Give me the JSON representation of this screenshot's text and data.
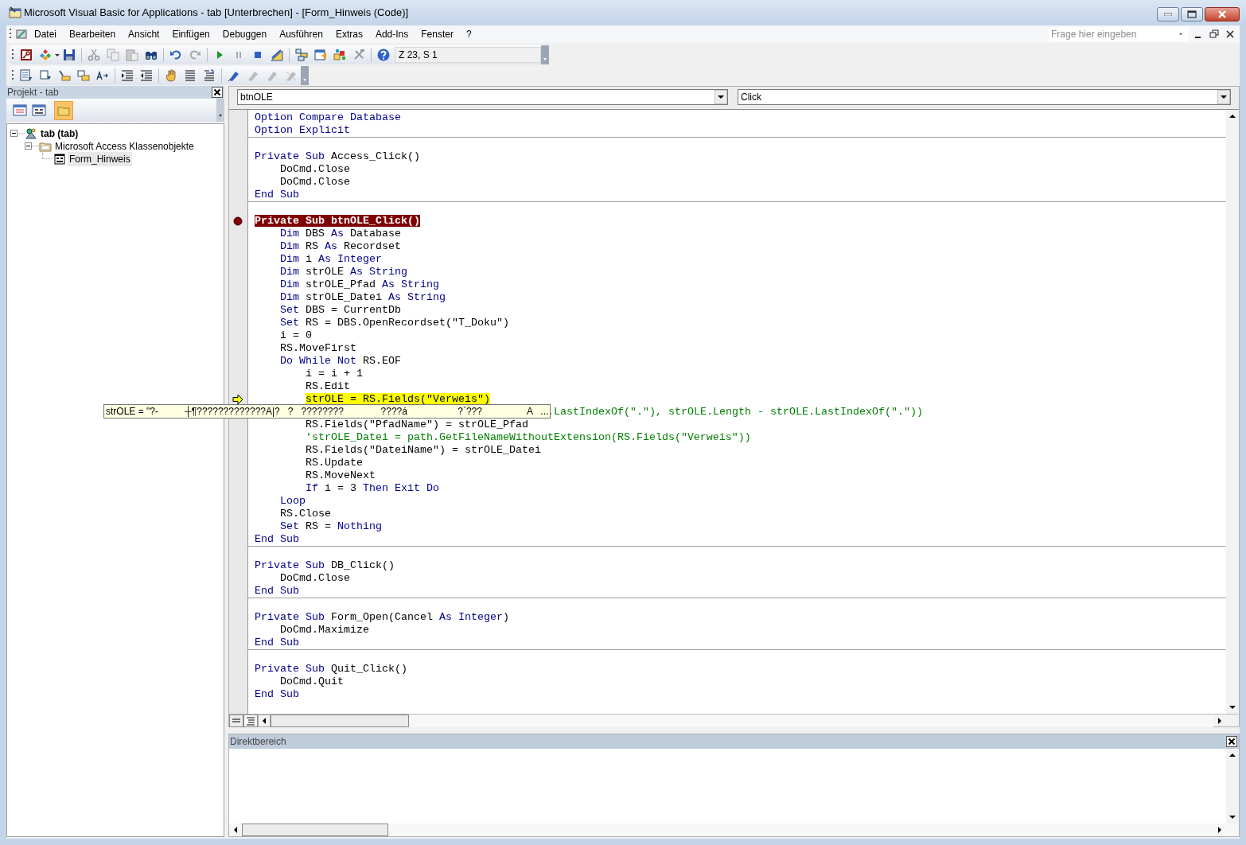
{
  "window": {
    "title": "Microsoft Visual Basic for Applications - tab [Unterbrechen] - [Form_Hinweis (Code)]"
  },
  "menu": [
    "Datei",
    "Bearbeiten",
    "Ansicht",
    "Einfügen",
    "Debuggen",
    "Ausführen",
    "Extras",
    "Add-Ins",
    "Fenster",
    "?"
  ],
  "help_search": {
    "placeholder": "Frage hier eingeben"
  },
  "cursor_position": "Z 23, S 1",
  "project_pane": {
    "title": "Projekt - tab",
    "tree": [
      {
        "label": "tab (tab)",
        "kind": "project",
        "expanded": true,
        "selected": false,
        "children": [
          {
            "label": "Microsoft Access Klassenobjekte",
            "kind": "folder",
            "expanded": true,
            "selected": false,
            "children": [
              {
                "label": "Form_Hinweis",
                "kind": "form",
                "selected": true
              }
            ]
          }
        ]
      }
    ]
  },
  "code_window": {
    "object_dropdown": "btnOLE",
    "procedure_dropdown": "Click",
    "blocks": [
      [
        {
          "kind": "code",
          "parts": [
            {
              "kind": "keyword",
              "text": "Option Compare Database"
            }
          ]
        },
        {
          "kind": "code",
          "parts": [
            {
              "kind": "keyword",
              "text": "Option Explicit"
            }
          ]
        }
      ],
      [
        {
          "kind": "blank"
        },
        {
          "kind": "code",
          "parts": [
            {
              "kind": "keyword",
              "text": "Private Sub "
            },
            {
              "kind": "plain",
              "text": "Access_Click()"
            }
          ]
        },
        {
          "kind": "code",
          "parts": [
            {
              "kind": "plain",
              "text": "    DoCmd.Close"
            }
          ]
        },
        {
          "kind": "code",
          "parts": [
            {
              "kind": "plain",
              "text": "    DoCmd.Close"
            }
          ]
        },
        {
          "kind": "code",
          "parts": [
            {
              "kind": "keyword",
              "text": "End Sub"
            }
          ]
        }
      ],
      [
        {
          "kind": "blank"
        },
        {
          "kind": "breakpoint",
          "parts": [
            {
              "kind": "keyword",
              "text": "Private Sub "
            },
            {
              "kind": "plain",
              "text": "btnOLE_Click()"
            }
          ]
        },
        {
          "kind": "code",
          "parts": [
            {
              "kind": "keyword",
              "text": "    Dim "
            },
            {
              "kind": "plain",
              "text": "DBS "
            },
            {
              "kind": "keyword",
              "text": "As "
            },
            {
              "kind": "plain",
              "text": "Database"
            }
          ]
        },
        {
          "kind": "code",
          "parts": [
            {
              "kind": "keyword",
              "text": "    Dim "
            },
            {
              "kind": "plain",
              "text": "RS "
            },
            {
              "kind": "keyword",
              "text": "As "
            },
            {
              "kind": "plain",
              "text": "Recordset"
            }
          ]
        },
        {
          "kind": "code",
          "parts": [
            {
              "kind": "keyword",
              "text": "    Dim "
            },
            {
              "kind": "plain",
              "text": "i "
            },
            {
              "kind": "keyword",
              "text": "As Integer"
            }
          ]
        },
        {
          "kind": "code",
          "parts": [
            {
              "kind": "keyword",
              "text": "    Dim "
            },
            {
              "kind": "plain",
              "text": "strOLE "
            },
            {
              "kind": "keyword",
              "text": "As String"
            }
          ]
        },
        {
          "kind": "code",
          "parts": [
            {
              "kind": "keyword",
              "text": "    Dim "
            },
            {
              "kind": "plain",
              "text": "strOLE_Pfad "
            },
            {
              "kind": "keyword",
              "text": "As String"
            }
          ]
        },
        {
          "kind": "code",
          "parts": [
            {
              "kind": "keyword",
              "text": "    Dim "
            },
            {
              "kind": "plain",
              "text": "strOLE_Datei "
            },
            {
              "kind": "keyword",
              "text": "As String"
            }
          ]
        },
        {
          "kind": "code",
          "parts": [
            {
              "kind": "keyword",
              "text": "    Set "
            },
            {
              "kind": "plain",
              "text": "DBS = CurrentDb"
            }
          ]
        },
        {
          "kind": "code",
          "parts": [
            {
              "kind": "keyword",
              "text": "    Set "
            },
            {
              "kind": "plain",
              "text": "RS = DBS.OpenRecordset(\"T_Doku\")"
            }
          ]
        },
        {
          "kind": "code",
          "parts": [
            {
              "kind": "plain",
              "text": "    i = 0"
            }
          ]
        },
        {
          "kind": "code",
          "parts": [
            {
              "kind": "plain",
              "text": "    RS.MoveFirst"
            }
          ]
        },
        {
          "kind": "code",
          "parts": [
            {
              "kind": "keyword",
              "text": "    Do While Not "
            },
            {
              "kind": "plain",
              "text": "RS.EOF"
            }
          ]
        },
        {
          "kind": "code",
          "parts": [
            {
              "kind": "plain",
              "text": "        i = i + 1"
            }
          ]
        },
        {
          "kind": "code",
          "parts": [
            {
              "kind": "plain",
              "text": "        RS.Edit"
            }
          ]
        },
        {
          "kind": "current",
          "parts": [
            {
              "kind": "plain",
              "text": "        strOLE = RS.Fields(\"Verweis\")"
            }
          ]
        },
        {
          "kind": "covered",
          "parts": [
            {
              "kind": "comment",
              "text": ".LastIndexOf(\".\"), strOLE.Length - strOLE.LastIndexOf(\".\"))"
            }
          ]
        },
        {
          "kind": "code",
          "parts": [
            {
              "kind": "plain",
              "text": "        RS.Fields(\"PfadName\") = strOLE_Pfad"
            }
          ]
        },
        {
          "kind": "code",
          "parts": [
            {
              "kind": "comment",
              "text": "        'strOLE_Datei = path.GetFileNameWithoutExtension(RS.Fields(\"Verweis\"))"
            }
          ]
        },
        {
          "kind": "code",
          "parts": [
            {
              "kind": "plain",
              "text": "        RS.Fields(\"DateiName\") = strOLE_Datei"
            }
          ]
        },
        {
          "kind": "code",
          "parts": [
            {
              "kind": "plain",
              "text": "        RS.Update"
            }
          ]
        },
        {
          "kind": "code",
          "parts": [
            {
              "kind": "plain",
              "text": "        RS.MoveNext"
            }
          ]
        },
        {
          "kind": "code",
          "parts": [
            {
              "kind": "keyword",
              "text": "        If "
            },
            {
              "kind": "plain",
              "text": "i = 3 "
            },
            {
              "kind": "keyword",
              "text": "Then Exit Do"
            }
          ]
        },
        {
          "kind": "code",
          "parts": [
            {
              "kind": "keyword",
              "text": "    Loop"
            }
          ]
        },
        {
          "kind": "code",
          "parts": [
            {
              "kind": "plain",
              "text": "    RS.Close"
            }
          ]
        },
        {
          "kind": "code",
          "parts": [
            {
              "kind": "keyword",
              "text": "    Set "
            },
            {
              "kind": "plain",
              "text": "RS = "
            },
            {
              "kind": "keyword",
              "text": "Nothing"
            }
          ]
        },
        {
          "kind": "code",
          "parts": [
            {
              "kind": "keyword",
              "text": "End Sub"
            }
          ]
        }
      ],
      [
        {
          "kind": "blank"
        },
        {
          "kind": "code",
          "parts": [
            {
              "kind": "keyword",
              "text": "Private Sub "
            },
            {
              "kind": "plain",
              "text": "DB_Click()"
            }
          ]
        },
        {
          "kind": "code",
          "parts": [
            {
              "kind": "plain",
              "text": "    DoCmd.Close"
            }
          ]
        },
        {
          "kind": "code",
          "parts": [
            {
              "kind": "keyword",
              "text": "End Sub"
            }
          ]
        }
      ],
      [
        {
          "kind": "blank"
        },
        {
          "kind": "code",
          "parts": [
            {
              "kind": "keyword",
              "text": "Private Sub "
            },
            {
              "kind": "plain",
              "text": "Form_Open(Cancel "
            },
            {
              "kind": "keyword",
              "text": "As Integer"
            },
            {
              "kind": "plain",
              "text": ")"
            }
          ]
        },
        {
          "kind": "code",
          "parts": [
            {
              "kind": "plain",
              "text": "    DoCmd.Maximize"
            }
          ]
        },
        {
          "kind": "code",
          "parts": [
            {
              "kind": "keyword",
              "text": "End Sub"
            }
          ]
        }
      ],
      [
        {
          "kind": "blank"
        },
        {
          "kind": "code",
          "parts": [
            {
              "kind": "keyword",
              "text": "Private Sub "
            },
            {
              "kind": "plain",
              "text": "Quit_Click()"
            }
          ]
        },
        {
          "kind": "code",
          "parts": [
            {
              "kind": "plain",
              "text": "    DoCmd.Quit"
            }
          ]
        },
        {
          "kind": "code",
          "parts": [
            {
              "kind": "keyword",
              "text": "End Sub"
            }
          ]
        }
      ]
    ]
  },
  "data_tip": "strOLE = \"?-          ┼¶?????????????A|?   ?   ????????              ????á                   ?`???                 A   ...",
  "immediate_pane": {
    "title": "Direktbereich"
  }
}
